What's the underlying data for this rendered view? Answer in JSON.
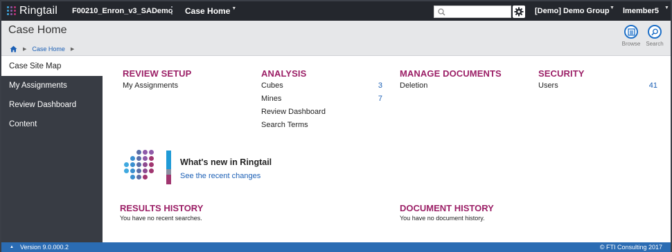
{
  "topbar": {
    "logo_text": "Ringtail",
    "case_name": "F00210_Enron_v3_SADemo",
    "case_menu_label": "Case Home",
    "search_placeholder": "",
    "settings_icon": "gear-icon",
    "group_label": "[Demo] Demo Group",
    "user_label": "lmember5"
  },
  "header": {
    "title": "Case Home",
    "breadcrumb": {
      "home_icon": "home-icon",
      "current": "Case Home"
    },
    "buttons": {
      "browse": "Browse",
      "search": "Search"
    }
  },
  "sidebar": {
    "items": [
      {
        "label": "Case Site Map",
        "active": true
      },
      {
        "label": "My Assignments",
        "active": false
      },
      {
        "label": "Review Dashboard",
        "active": false
      },
      {
        "label": "Content",
        "active": false
      }
    ]
  },
  "sections": {
    "review_setup": {
      "title": "REVIEW SETUP",
      "rows": [
        {
          "label": "My Assignments",
          "count": ""
        }
      ]
    },
    "analysis": {
      "title": "ANALYSIS",
      "rows": [
        {
          "label": "Cubes",
          "count": "3"
        },
        {
          "label": "Mines",
          "count": "7"
        },
        {
          "label": "Review Dashboard",
          "count": ""
        },
        {
          "label": "Search Terms",
          "count": ""
        }
      ]
    },
    "manage_documents": {
      "title": "MANAGE DOCUMENTS",
      "rows": [
        {
          "label": "Deletion",
          "count": ""
        }
      ]
    },
    "security": {
      "title": "SECURITY",
      "rows": [
        {
          "label": "Users",
          "count": "41"
        }
      ]
    }
  },
  "whats_new": {
    "title": "What's new in Ringtail",
    "link": "See the recent changes"
  },
  "history": {
    "results": {
      "title": "RESULTS HISTORY",
      "text": "You have no recent searches."
    },
    "documents": {
      "title": "DOCUMENT HISTORY",
      "text": "You have no document history."
    }
  },
  "footer": {
    "version": "Version 9.0.000.2",
    "copyright": "© FTI Consulting 2017"
  },
  "colors": {
    "accent": "#9b1f66",
    "link": "#1b5fb5",
    "topbar": "#24272d",
    "sidebar": "#383c44",
    "footer": "#2b6cb3"
  }
}
